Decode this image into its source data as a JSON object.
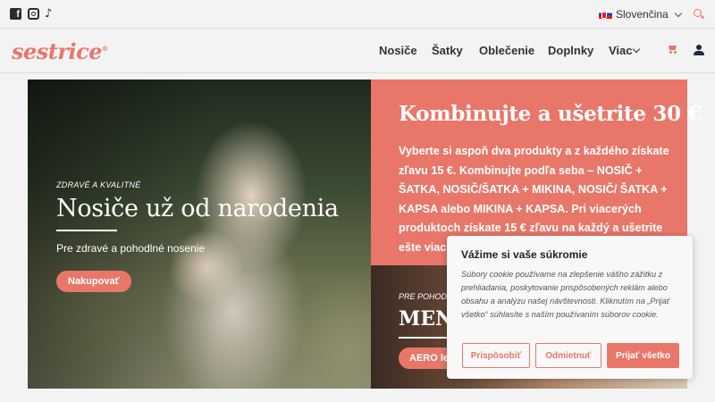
{
  "topbar": {
    "social": [
      "facebook-icon",
      "instagram-icon",
      "tiktok-icon"
    ],
    "language": "Slovenčina",
    "search_icon": "search-icon"
  },
  "nav": {
    "logo": "sestrice",
    "items": [
      "Nosiče",
      "Šatky",
      "Oblečenie",
      "Doplnky",
      "Viac"
    ],
    "cart_icon": "cart-icon",
    "user_icon": "user-icon"
  },
  "hero": {
    "eyebrow": "Zdravé a kvalitné",
    "title": "Nosiče už od narodenia",
    "subtitle": "Pre zdravé a pohodlné nosenie",
    "button": "Nakupovať"
  },
  "promo": {
    "title": "Kombinujte a ušetrite 30 €",
    "text": "Vyberte si aspoň dva produkty a z každého získate zľavu 15 €. Kombinujte podľa seba – NOSIČ + ŠATKA, NOSIČ/ŠATKA + MIKINA, NOSIČ/ ŠATKA + KAPSA alebo MIKINA + KAPSA. Pri viacerých produktoch získate 15 € zľavu na každý a ušetrite ešte viac!"
  },
  "promo2": {
    "eyebrow": "Pre pohodlie",
    "title": "MENŠIE",
    "button": "AERO leto"
  },
  "cookie": {
    "title": "Vážime si vaše súkromie",
    "text": "Súbory cookie používame na zlepšenie vášho zážitku z prehliadania, poskytovanie prispôsobených reklám alebo obsahu a analýzu našej návštevnosti. Kliknutím na „Prijať všetko“ súhlasíte s naším používaním súborov cookie.",
    "btn_customize": "Prispôsobiť",
    "btn_reject": "Odmietnuť",
    "btn_accept": "Prijať všetko"
  },
  "colors": {
    "accent": "#e8776a",
    "background": "#f3f3f3"
  }
}
